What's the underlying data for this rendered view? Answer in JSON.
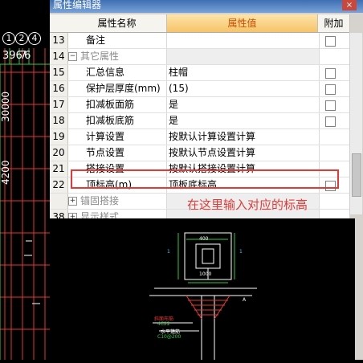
{
  "window": {
    "title": "属性编辑器",
    "close_label": "×"
  },
  "grid": {
    "headers": {
      "name": "属性名称",
      "value": "属性值",
      "extra": "附加"
    },
    "rows": [
      {
        "num": "13",
        "name": "备注",
        "value": "",
        "checkbox": true
      },
      {
        "num": "14",
        "name": "其它属性",
        "value": "",
        "group": true,
        "expander": "−"
      },
      {
        "num": "15",
        "name": "汇总信息",
        "value": "柱帽",
        "checkbox": true
      },
      {
        "num": "16",
        "name": "保护层厚度(mm)",
        "value": "(15)",
        "checkbox": true
      },
      {
        "num": "17",
        "name": "扣减板面筋",
        "value": "是",
        "checkbox": true
      },
      {
        "num": "18",
        "name": "扣减板底筋",
        "value": "是",
        "checkbox": true
      },
      {
        "num": "19",
        "name": "计算设置",
        "value": "按默认计算设置计算",
        "checkbox": false
      },
      {
        "num": "20",
        "name": "节点设置",
        "value": "按默认节点设置计算",
        "checkbox": false
      },
      {
        "num": "21",
        "name": "搭接设置",
        "value": "按默认搭接设置计算",
        "checkbox": false
      },
      {
        "num": "22",
        "name": "顶标高(m)",
        "value": "顶板底标高",
        "checkbox": true
      },
      {
        "num": "",
        "name": "锚固搭接",
        "value": "",
        "group": true,
        "expander": "+"
      },
      {
        "num": "38",
        "name": "显示样式",
        "value": "",
        "group": true,
        "expander": "+"
      }
    ]
  },
  "annotation": "在这里输入对应的标高",
  "cad": {
    "axis_labels": [
      "1",
      "2",
      "4"
    ],
    "top_dims": "39",
    "top_dims_b": "676",
    "vertical_dim": "30000",
    "vertical_dim_b": "4200"
  },
  "preview": {
    "dim_top": "400",
    "dim_bottom": "1000",
    "dim_left": "1",
    "dim_right": "1",
    "label_a": "A",
    "note_1": "斜面布筋",
    "note_2": "4C22",
    "note_3": "水平箍筋",
    "note_4": "C10@200"
  },
  "colors": {
    "accent": "#cc4b00",
    "highlight": "#e53935",
    "cad_red": "#e53935",
    "cad_green": "#2ecc40"
  }
}
